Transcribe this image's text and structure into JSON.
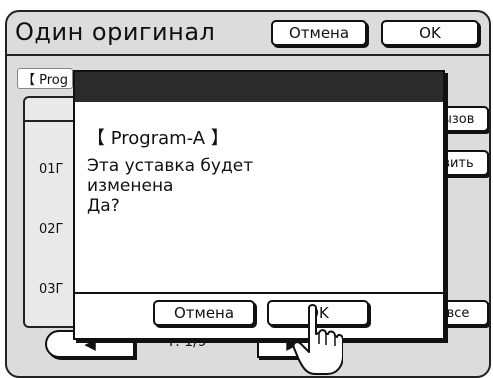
{
  "header": {
    "title": "Один оригинал",
    "cancel_label": "Отмена",
    "ok_label": "OK"
  },
  "background": {
    "program_tag": "【 Prog",
    "rows": [
      "01Г",
      "02Г",
      "03Г"
    ],
    "right_buttons": [
      "ызов",
      "вить",
      "все"
    ]
  },
  "pager": {
    "prev_icon": "◀",
    "page": "P. 1/9",
    "next_icon": "▶"
  },
  "dialog": {
    "program": "【 Program-A 】",
    "message": "Эта уставка будет\nизменена\nДа?",
    "cancel_label": "Отмена",
    "ok_label": "OK"
  },
  "colors": {
    "screen_bg": "#dcdcdc",
    "dialog_bar": "#2b2b2b",
    "border": "#111111"
  },
  "icons": {
    "pointer": "hand-pointer-icon"
  }
}
